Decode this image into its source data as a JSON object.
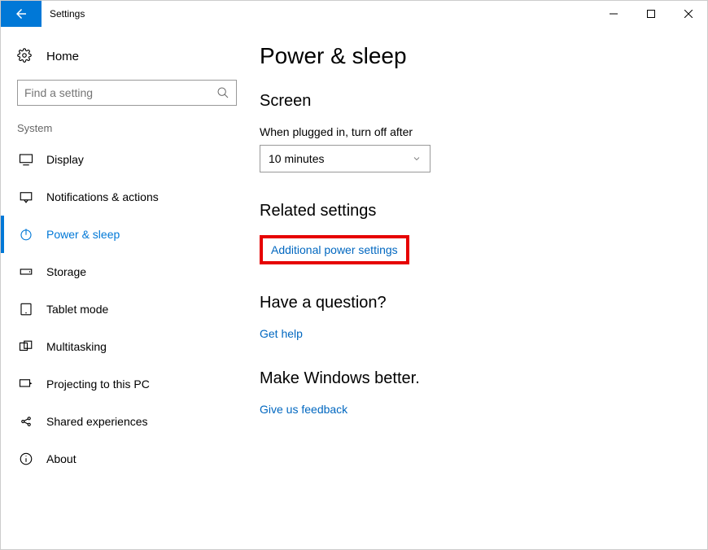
{
  "window": {
    "title": "Settings"
  },
  "sidebar": {
    "home_label": "Home",
    "search_placeholder": "Find a setting",
    "category_label": "System",
    "items": [
      {
        "label": "Display"
      },
      {
        "label": "Notifications & actions"
      },
      {
        "label": "Power & sleep"
      },
      {
        "label": "Storage"
      },
      {
        "label": "Tablet mode"
      },
      {
        "label": "Multitasking"
      },
      {
        "label": "Projecting to this PC"
      },
      {
        "label": "Shared experiences"
      },
      {
        "label": "About"
      }
    ]
  },
  "main": {
    "page_title": "Power & sleep",
    "screen": {
      "heading": "Screen",
      "label": "When plugged in, turn off after",
      "value": "10 minutes"
    },
    "related": {
      "heading": "Related settings",
      "link": "Additional power settings"
    },
    "question": {
      "heading": "Have a question?",
      "link": "Get help"
    },
    "feedback": {
      "heading": "Make Windows better.",
      "link": "Give us feedback"
    }
  }
}
